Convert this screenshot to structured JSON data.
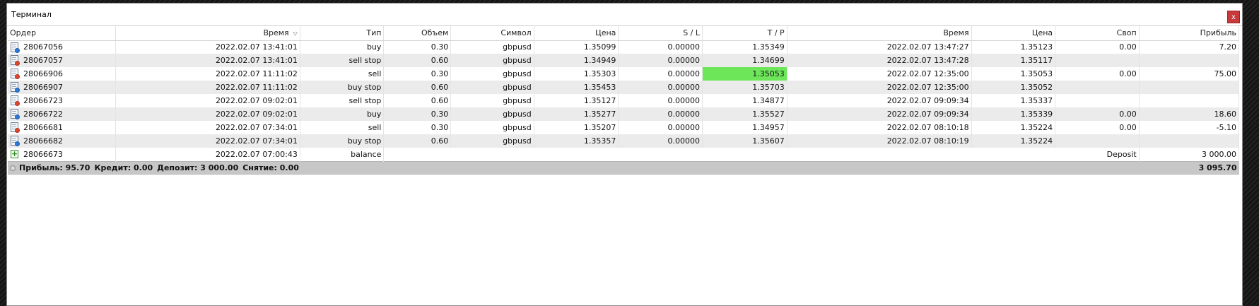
{
  "window": {
    "title": "Терминал",
    "close_label": "x"
  },
  "columns": {
    "order": "Ордер",
    "open_time": "Время",
    "type": "Тип",
    "volume": "Объем",
    "symbol": "Символ",
    "open_price": "Цена",
    "sl": "S / L",
    "tp": "T / P",
    "close_time": "Время",
    "close_price": "Цена",
    "swap": "Своп",
    "profit": "Прибыль"
  },
  "sort_indicator": "▽",
  "rows": [
    {
      "order": "28067056",
      "open_time": "2022.02.07 13:41:01",
      "type": "buy",
      "volume": "0.30",
      "symbol": "gbpusd",
      "open_price": "1.35099",
      "sl": "0.00000",
      "tp": "1.35349",
      "close_time": "2022.02.07 13:47:27",
      "close_price": "1.35123",
      "swap": "0.00",
      "profit": "7.20",
      "icon": "blue"
    },
    {
      "order": "28067057",
      "open_time": "2022.02.07 13:41:01",
      "type": "sell stop",
      "volume": "0.60",
      "symbol": "gbpusd",
      "open_price": "1.34949",
      "sl": "0.00000",
      "tp": "1.34699",
      "close_time": "2022.02.07 13:47:28",
      "close_price": "1.35117",
      "swap": "",
      "profit": "",
      "icon": "red"
    },
    {
      "order": "28066906",
      "open_time": "2022.02.07 11:11:02",
      "type": "sell",
      "volume": "0.30",
      "symbol": "gbpusd",
      "open_price": "1.35303",
      "sl": "0.00000",
      "tp": "1.35053",
      "close_time": "2022.02.07 12:35:00",
      "close_price": "1.35053",
      "swap": "0.00",
      "profit": "75.00",
      "icon": "red",
      "tp_highlight": true
    },
    {
      "order": "28066907",
      "open_time": "2022.02.07 11:11:02",
      "type": "buy stop",
      "volume": "0.60",
      "symbol": "gbpusd",
      "open_price": "1.35453",
      "sl": "0.00000",
      "tp": "1.35703",
      "close_time": "2022.02.07 12:35:00",
      "close_price": "1.35052",
      "swap": "",
      "profit": "",
      "icon": "blue"
    },
    {
      "order": "28066723",
      "open_time": "2022.02.07 09:02:01",
      "type": "sell stop",
      "volume": "0.60",
      "symbol": "gbpusd",
      "open_price": "1.35127",
      "sl": "0.00000",
      "tp": "1.34877",
      "close_time": "2022.02.07 09:09:34",
      "close_price": "1.35337",
      "swap": "",
      "profit": "",
      "icon": "red"
    },
    {
      "order": "28066722",
      "open_time": "2022.02.07 09:02:01",
      "type": "buy",
      "volume": "0.30",
      "symbol": "gbpusd",
      "open_price": "1.35277",
      "sl": "0.00000",
      "tp": "1.35527",
      "close_time": "2022.02.07 09:09:34",
      "close_price": "1.35339",
      "swap": "0.00",
      "profit": "18.60",
      "icon": "blue"
    },
    {
      "order": "28066681",
      "open_time": "2022.02.07 07:34:01",
      "type": "sell",
      "volume": "0.30",
      "symbol": "gbpusd",
      "open_price": "1.35207",
      "sl": "0.00000",
      "tp": "1.34957",
      "close_time": "2022.02.07 08:10:18",
      "close_price": "1.35224",
      "swap": "0.00",
      "profit": "-5.10",
      "icon": "red"
    },
    {
      "order": "28066682",
      "open_time": "2022.02.07 07:34:01",
      "type": "buy stop",
      "volume": "0.60",
      "symbol": "gbpusd",
      "open_price": "1.35357",
      "sl": "0.00000",
      "tp": "1.35607",
      "close_time": "2022.02.07 08:10:19",
      "close_price": "1.35224",
      "swap": "",
      "profit": "",
      "icon": "blue"
    }
  ],
  "balance_row": {
    "order": "28066673",
    "open_time": "2022.02.07 07:00:43",
    "type": "balance",
    "comment": "Deposit",
    "profit": "3 000.00"
  },
  "summary": {
    "profit_label": "Прибыль:",
    "profit_value": "95.70",
    "credit_label": "Кредит:",
    "credit_value": "0.00",
    "deposit_label": "Депозит:",
    "deposit_value": "3 000.00",
    "withdrawal_label": "Снятие:",
    "withdrawal_value": "0.00",
    "total": "3 095.70"
  },
  "colors": {
    "tp_highlight": "#6ee65a",
    "close_button": "#c8393b",
    "summary_bg": "#c7c7c7"
  }
}
